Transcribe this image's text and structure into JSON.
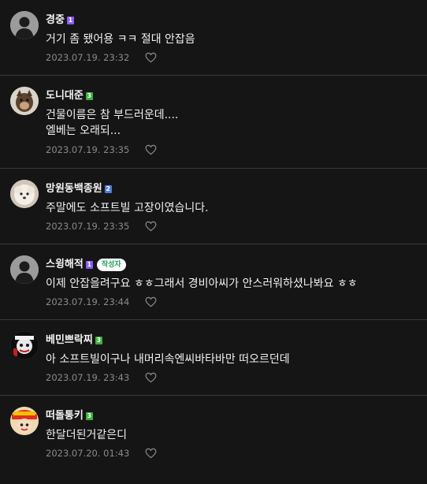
{
  "comments": [
    {
      "nickname": "경중",
      "badge": "1",
      "badge_color": "#8b5cf6",
      "lines": [
        "거기 좀 됐어용 ㅋㅋ 절대 안잡음"
      ],
      "date": "2023.07.19. 23:32",
      "avatar": "default-avatar"
    },
    {
      "nickname": "도니대준",
      "badge": "3",
      "badge_color": "#3fae3f",
      "lines": [
        "건물이름은 참 부드러운데....",
        "엘베는 오래되..."
      ],
      "date": "2023.07.19. 23:35",
      "avatar": "dog-photo-avatar"
    },
    {
      "nickname": "망원동백종원",
      "badge": "2",
      "badge_color": "#4c7dd9",
      "lines": [
        "주말에도 소프트빌 고장이였습니다."
      ],
      "date": "2023.07.19. 23:35",
      "avatar": "white-dog-avatar"
    },
    {
      "nickname": "스윙해적",
      "badge": "1",
      "badge_color": "#8b5cf6",
      "writer_tag": "작성자",
      "lines": [
        "이제 안잡을려구요 ㅎㅎ그래서 경비아씨가 안스러워하셨나봐요 ㅎㅎ"
      ],
      "date": "2023.07.19. 23:44",
      "avatar": "default-avatar"
    },
    {
      "nickname": "베민쁘락찌",
      "badge": "3",
      "badge_color": "#3fae3f",
      "lines": [
        "아 소프트빌이구나 내머리속엔씨바타바만 떠오르던데"
      ],
      "date": "2023.07.19. 23:43",
      "avatar": "cartoon-avatar"
    },
    {
      "nickname": "떠돌통키",
      "badge": "3",
      "badge_color": "#3fae3f",
      "lines": [
        "한달더된거같은디"
      ],
      "date": "2023.07.20. 01:43",
      "avatar": "anime-avatar"
    }
  ],
  "icons": {
    "like": "heart-icon"
  }
}
